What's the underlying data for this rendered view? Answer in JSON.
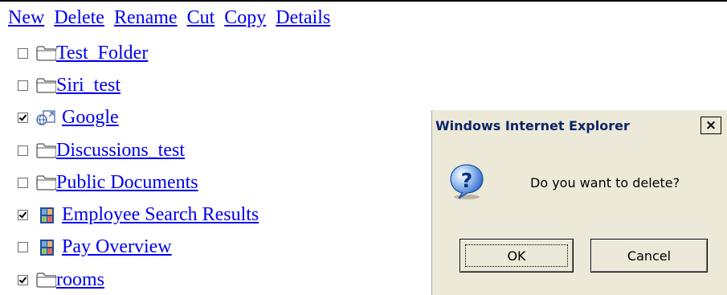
{
  "toolbar": {
    "new": "New",
    "delete": "Delete",
    "rename": "Rename",
    "cut": "Cut",
    "copy": "Copy",
    "details": "Details"
  },
  "items": [
    {
      "label": "Test_Folder",
      "checked": false,
      "icon": "folder-icon"
    },
    {
      "label": "Siri_test",
      "checked": false,
      "icon": "folder-icon"
    },
    {
      "label": "Google",
      "checked": true,
      "icon": "web-link-icon"
    },
    {
      "label": "Discussions_test",
      "checked": false,
      "icon": "folder-icon"
    },
    {
      "label": "Public Documents",
      "checked": false,
      "icon": "folder-icon"
    },
    {
      "label": "Employee Search Results",
      "checked": true,
      "icon": "report-icon"
    },
    {
      "label": "Pay Overview",
      "checked": false,
      "icon": "report-icon"
    },
    {
      "label": "rooms",
      "checked": true,
      "icon": "folder-icon"
    }
  ],
  "dialog": {
    "title": "Windows Internet Explorer",
    "close_glyph": "×",
    "message": "Do you want to delete?",
    "ok_label": "OK",
    "cancel_label": "Cancel",
    "icon": "question-icon"
  },
  "colors": {
    "link": "#0000ee",
    "dialog_bg": "#ece9d8",
    "title_text": "#0a246a"
  }
}
